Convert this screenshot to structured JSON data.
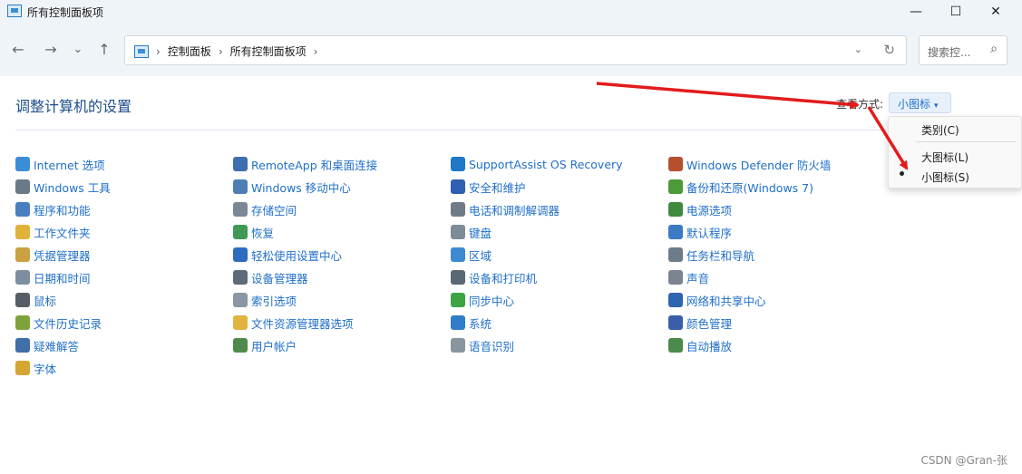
{
  "window": {
    "title": "所有控制面板项",
    "controls": {
      "minimize": "—",
      "maximize": "☐",
      "close": "✕"
    }
  },
  "nav": {
    "back": "←",
    "forward": "→",
    "recent": "⌄",
    "up": "↑",
    "breadcrumbs": [
      "控制面板",
      "所有控制面板项"
    ],
    "separator": "›",
    "dropdown": "⌄",
    "refresh": "↻",
    "search_placeholder": "搜索控...",
    "search_icon": "⌕"
  },
  "main": {
    "heading": "调整计算机的设置",
    "view_by_label": "查看方式:",
    "view_by_value": "小图标",
    "view_caret": "▾"
  },
  "view_menu": {
    "items": [
      "类别(C)",
      "大图标(L)",
      "小图标(S)"
    ],
    "selected": "小图标(S)"
  },
  "items": [
    {
      "label": "Internet 选项",
      "icon": "globe-icon",
      "color": "#3b8ed6"
    },
    {
      "label": "Windows 工具",
      "icon": "gears-icon",
      "color": "#6b7a89"
    },
    {
      "label": "程序和功能",
      "icon": "programs-icon",
      "color": "#4a7fbf"
    },
    {
      "label": "工作文件夹",
      "icon": "folder-icon",
      "color": "#e2b13c"
    },
    {
      "label": "凭据管理器",
      "icon": "credential-icon",
      "color": "#c9a042"
    },
    {
      "label": "日期和时间",
      "icon": "clock-icon",
      "color": "#7d8ea0"
    },
    {
      "label": "鼠标",
      "icon": "mouse-icon",
      "color": "#555e66"
    },
    {
      "label": "文件历史记录",
      "icon": "file-history-icon",
      "color": "#7fa33c"
    },
    {
      "label": "疑难解答",
      "icon": "troubleshoot-icon",
      "color": "#3f6ea8"
    },
    {
      "label": "字体",
      "icon": "font-icon",
      "color": "#d6a533"
    },
    {
      "label": "RemoteApp 和桌面连接",
      "icon": "remoteapp-icon",
      "color": "#3e6fae"
    },
    {
      "label": "Windows 移动中心",
      "icon": "mobility-icon",
      "color": "#4d7fb5"
    },
    {
      "label": "存储空间",
      "icon": "storage-icon",
      "color": "#7a8795"
    },
    {
      "label": "恢复",
      "icon": "recovery-icon",
      "color": "#3f9a56"
    },
    {
      "label": "轻松使用设置中心",
      "icon": "ease-of-access-icon",
      "color": "#2f6cc0"
    },
    {
      "label": "设备管理器",
      "icon": "device-manager-icon",
      "color": "#5d6b78"
    },
    {
      "label": "索引选项",
      "icon": "indexing-icon",
      "color": "#8a96a3"
    },
    {
      "label": "文件资源管理器选项",
      "icon": "folder-options-icon",
      "color": "#e0b43e"
    },
    {
      "label": "用户帐户",
      "icon": "user-accounts-icon",
      "color": "#4e8a4b"
    },
    {
      "label": "SupportAssist OS Recovery",
      "icon": "supportassist-icon",
      "color": "#1f78c8"
    },
    {
      "label": "安全和维护",
      "icon": "flag-icon",
      "color": "#2e5fb0"
    },
    {
      "label": "电话和调制解调器",
      "icon": "phone-icon",
      "color": "#6f7b86"
    },
    {
      "label": "键盘",
      "icon": "keyboard-icon",
      "color": "#7f8b96"
    },
    {
      "label": "区域",
      "icon": "region-icon",
      "color": "#3c8bd0"
    },
    {
      "label": "设备和打印机",
      "icon": "printer-icon",
      "color": "#5a6774"
    },
    {
      "label": "同步中心",
      "icon": "sync-icon",
      "color": "#3aa542"
    },
    {
      "label": "系统",
      "icon": "system-icon",
      "color": "#2f7dc8"
    },
    {
      "label": "语音识别",
      "icon": "microphone-icon",
      "color": "#8a949d"
    },
    {
      "label": "Windows Defender 防火墙",
      "icon": "firewall-icon",
      "color": "#b5502f"
    },
    {
      "label": "备份和还原(Windows 7)",
      "icon": "backup-icon",
      "color": "#4c9a3a"
    },
    {
      "label": "电源选项",
      "icon": "power-icon",
      "color": "#3f8a3f"
    },
    {
      "label": "默认程序",
      "icon": "default-programs-icon",
      "color": "#3b7bc4"
    },
    {
      "label": "任务栏和导航",
      "icon": "taskbar-icon",
      "color": "#6e7c8a"
    },
    {
      "label": "声音",
      "icon": "speaker-icon",
      "color": "#7b8591"
    },
    {
      "label": "网络和共享中心",
      "icon": "network-icon",
      "color": "#2e64b0"
    },
    {
      "label": "颜色管理",
      "icon": "color-management-icon",
      "color": "#3a5fa8"
    },
    {
      "label": "自动播放",
      "icon": "autoplay-icon",
      "color": "#4a8a4a"
    }
  ],
  "watermark": "CSDN @Gran-张",
  "annotation_color": "#e31b1b"
}
